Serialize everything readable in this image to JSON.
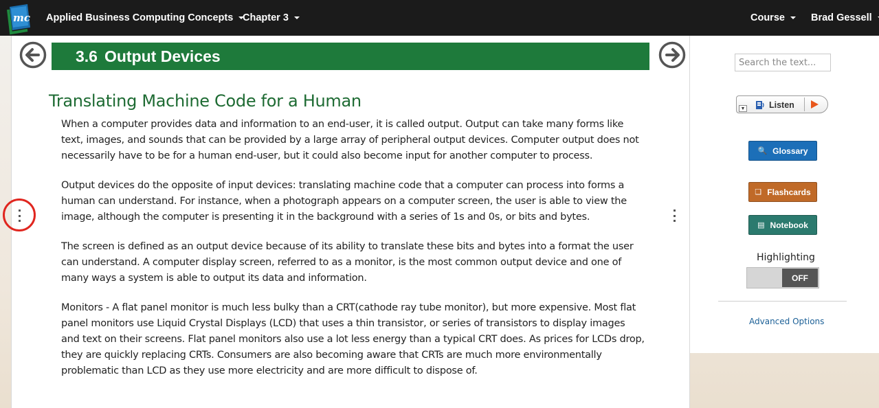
{
  "navbar": {
    "book_title": "Applied Business Computing Concepts",
    "chapter": "Chapter 3",
    "course": "Course",
    "user": "Brad Gessell"
  },
  "section": {
    "number": "3.6",
    "title": "Output Devices"
  },
  "heading": "Translating Machine Code for a Human",
  "paragraphs": [
    "When a computer provides data and information to an end-user, it is called output. Output can take many forms like text, images, and sounds that can be provided by a large array of peripheral output devices. Computer output does not necessarily have to be for a human end-user, but it could also become input for another computer to process.",
    "Output devices do the opposite of input devices: translating machine code that a computer can process into forms a human can understand. For instance, when a photograph appears on a computer screen, the user is able to view the image, although the computer is presenting it in the background with a series of 1s and 0s, or bits and bytes.",
    "The screen is defined as an output device because of its ability to translate these bits and bytes into a format the user can understand. A computer display screen, referred to as a monitor, is the most common output device and one of many ways a system is able to output its data and information.",
    "Monitors - A flat panel monitor is much less bulky than a CRT(cathode ray tube monitor), but more expensive. Most flat panel monitors use Liquid Crystal Displays (LCD) that uses a thin transistor, or series of transistors to display images and text on their screens. Flat panel monitors also use a lot less energy than a typical CRT does. As prices for LCDs drop, they are quickly replacing CRTs. Consumers are also becoming aware that CRTs are much more environmentally problematic than LCD as they use more electricity and are more difficult to dispose of."
  ],
  "sidebar": {
    "search_placeholder": "Search the text...",
    "listen_label": "Listen",
    "glossary_label": "Glossary",
    "flashcards_label": "Flashcards",
    "notebook_label": "Notebook",
    "highlighting_label": "Highlighting",
    "highlighting_state": "OFF",
    "advanced_options": "Advanced Options"
  },
  "colors": {
    "banner": "#1e7a3b",
    "heading": "#1e6b33",
    "glossary": "#1c6fb8",
    "flashcards": "#c06a28",
    "notebook": "#2b7a6e",
    "annotation_circle": "#e0261f"
  },
  "icons": [
    "app-logo-icon",
    "chevron-down-icon",
    "arrow-left-circle-icon",
    "arrow-right-circle-icon",
    "kebab-menu-icon",
    "speaker-icon",
    "play-icon",
    "search-icon",
    "flashcards-icon",
    "notebook-icon"
  ]
}
